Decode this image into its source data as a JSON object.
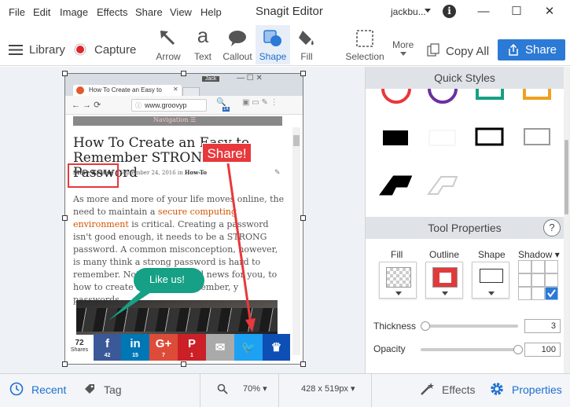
{
  "menu": [
    "File",
    "Edit",
    "Image",
    "Effects",
    "Share",
    "View",
    "Help"
  ],
  "window": {
    "title": "Snagit Editor",
    "user": "jackbu...",
    "info": "i",
    "minimize": "—",
    "maximize": "☐",
    "close": "✕"
  },
  "toolbar": {
    "library": "Library",
    "capture": "Capture",
    "tools": [
      {
        "label": "Arrow"
      },
      {
        "label": "Text"
      },
      {
        "label": "Callout"
      },
      {
        "label": "Shape"
      },
      {
        "label": "Fill"
      },
      {
        "label": "Selection"
      }
    ],
    "text_glyph": "a",
    "more": "More",
    "copy_all": "Copy All",
    "share": "Share"
  },
  "capture_image": {
    "tab_user": "Jack",
    "tab_title": "How To Create an Easy to",
    "url": "www.groovyp",
    "ext_badge": "14",
    "nav": "Navigation ☰",
    "headline": "How To Create an Easy to Remember STRONG Password",
    "author": "Steve Krause",
    "date": "| September 24, 2016 in",
    "category": "How-To",
    "p1": "As more and more of your life moves online, the need to maintain a",
    "link": "secure computing environment",
    "p2": "is critical. Creating a password isn't good enough, it needs to be a STRONG password. A common misconception, however, is many think a strong password is hard to remember. Not true and good news for you, to how to create an easy to remember, y                passwords.",
    "share_count": "72",
    "share_word": "Shares",
    "social": [
      {
        "icon": "f",
        "count": "42",
        "color": "#3b5998"
      },
      {
        "icon": "in",
        "count": "15",
        "color": "#0077b5"
      },
      {
        "icon": "G+",
        "count": "7",
        "color": "#dd4b39"
      },
      {
        "icon": "P",
        "count": "1",
        "color": "#cb2027"
      },
      {
        "icon": "✉",
        "count": "",
        "color": "#aaaaaa"
      },
      {
        "icon": "🐦",
        "count": "",
        "color": "#1da1f2"
      },
      {
        "icon": "♛",
        "count": "",
        "color": "#0d4fb5"
      }
    ],
    "callout_share": "Share!",
    "callout_like": "Like us!"
  },
  "panel": {
    "quick_styles": "Quick Styles",
    "tool_properties": "Tool Properties",
    "help": "?",
    "fill": "Fill",
    "outline": "Outline",
    "shape": "Shape",
    "shadow": "Shadow ▾",
    "thickness_label": "Thickness",
    "thickness_value": "3",
    "thickness_level": 0.05,
    "opacity_label": "Opacity",
    "opacity_value": "100",
    "opacity_level": 1.0,
    "outline_color": "#e03a3a"
  },
  "bottom": {
    "recent": "Recent",
    "tag": "Tag",
    "zoom": "70% ▾",
    "size": "428 x 519px ▾",
    "effects": "Effects",
    "properties": "Properties"
  },
  "colors": {
    "accent": "#2c7ad6",
    "callout_red": "#e8383b",
    "callout_green": "#16a085"
  }
}
